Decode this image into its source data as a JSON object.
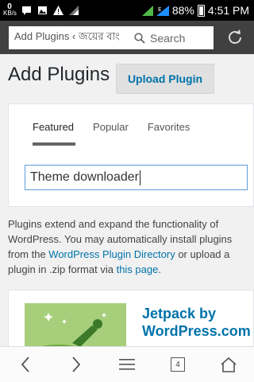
{
  "status_bar": {
    "speed_value": "0",
    "speed_unit": "KB/s",
    "battery": "88%",
    "time": "4:51 PM"
  },
  "browser": {
    "url_text": "Add Plugins ‹ জয়ের বাং",
    "search_label": "Search"
  },
  "page": {
    "title": "Add Plugins",
    "upload_button": "Upload Plugin",
    "tabs": [
      {
        "label": "Featured",
        "active": true
      },
      {
        "label": "Popular",
        "active": false
      },
      {
        "label": "Favorites",
        "active": false
      }
    ],
    "search_value": "Theme downloader",
    "description": {
      "part1": "Plugins extend and expand the functionality of WordPress. You may automatically install plugins from the ",
      "link1": "WordPress Plugin Directory",
      "part2": " or upload a plugin in .zip format via ",
      "link2": "this page",
      "part3": "."
    },
    "plugin": {
      "name": "Jetpack by WordPress.com"
    }
  },
  "nav": {
    "tabs_count": "4"
  }
}
